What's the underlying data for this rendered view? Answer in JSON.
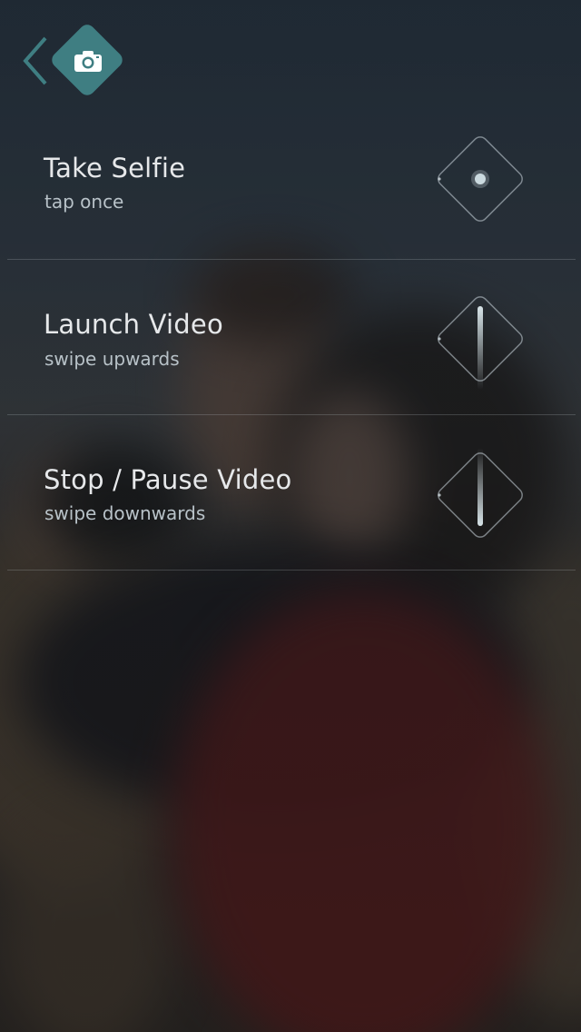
{
  "header": {
    "back_icon": "chevron-left-icon",
    "badge_icon": "camera-icon",
    "badge_color": "#3f7e82"
  },
  "gestures": [
    {
      "title": "Take Selfie",
      "subtitle": "tap once",
      "icon": "tap-gesture-icon"
    },
    {
      "title": "Launch Video",
      "subtitle": "swipe upwards",
      "icon": "swipe-up-gesture-icon"
    },
    {
      "title": "Stop / Pause Video",
      "subtitle": "swipe downwards",
      "icon": "swipe-down-gesture-icon"
    }
  ]
}
